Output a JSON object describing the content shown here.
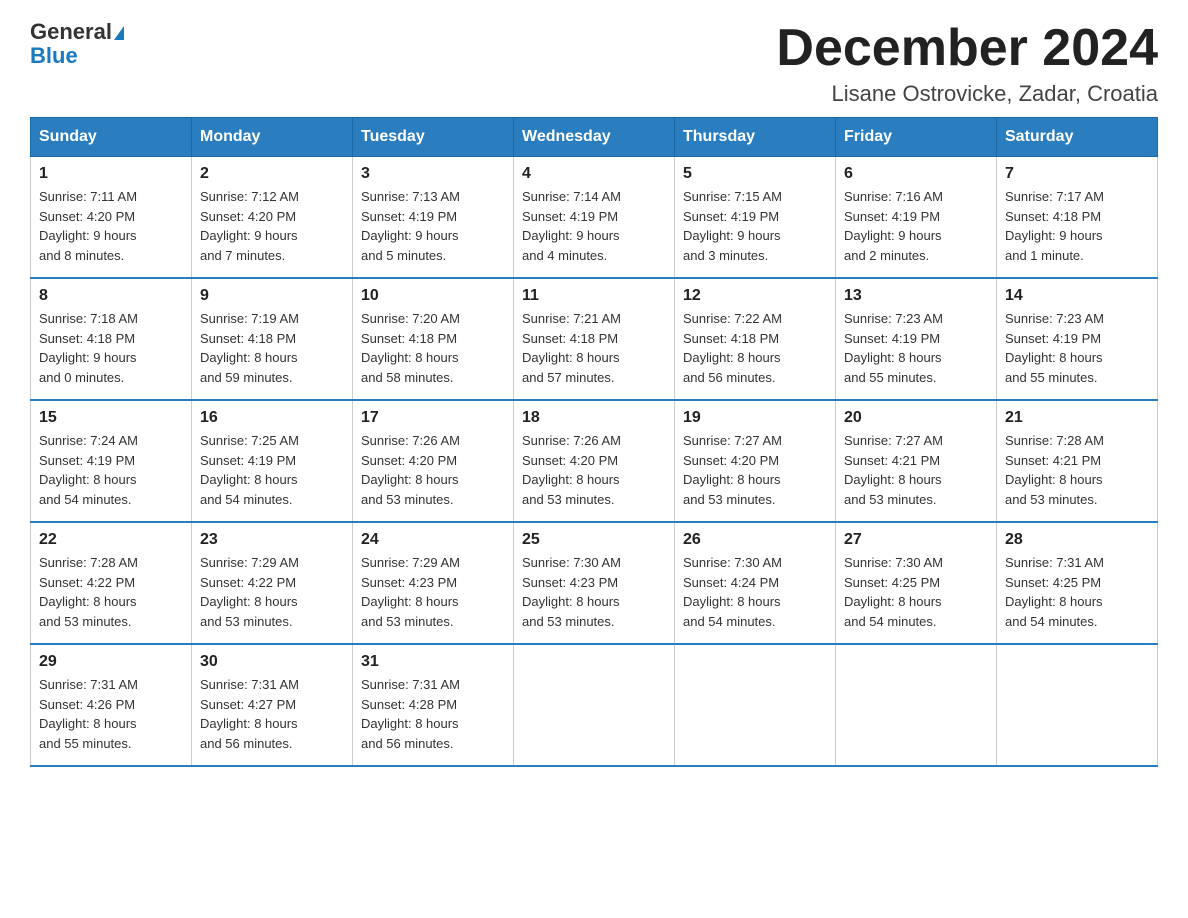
{
  "header": {
    "logo_line1": "General",
    "logo_line2": "Blue",
    "title": "December 2024",
    "subtitle": "Lisane Ostrovicke, Zadar, Croatia"
  },
  "days_of_week": [
    "Sunday",
    "Monday",
    "Tuesday",
    "Wednesday",
    "Thursday",
    "Friday",
    "Saturday"
  ],
  "weeks": [
    [
      {
        "day": "1",
        "info": "Sunrise: 7:11 AM\nSunset: 4:20 PM\nDaylight: 9 hours\nand 8 minutes."
      },
      {
        "day": "2",
        "info": "Sunrise: 7:12 AM\nSunset: 4:20 PM\nDaylight: 9 hours\nand 7 minutes."
      },
      {
        "day": "3",
        "info": "Sunrise: 7:13 AM\nSunset: 4:19 PM\nDaylight: 9 hours\nand 5 minutes."
      },
      {
        "day": "4",
        "info": "Sunrise: 7:14 AM\nSunset: 4:19 PM\nDaylight: 9 hours\nand 4 minutes."
      },
      {
        "day": "5",
        "info": "Sunrise: 7:15 AM\nSunset: 4:19 PM\nDaylight: 9 hours\nand 3 minutes."
      },
      {
        "day": "6",
        "info": "Sunrise: 7:16 AM\nSunset: 4:19 PM\nDaylight: 9 hours\nand 2 minutes."
      },
      {
        "day": "7",
        "info": "Sunrise: 7:17 AM\nSunset: 4:18 PM\nDaylight: 9 hours\nand 1 minute."
      }
    ],
    [
      {
        "day": "8",
        "info": "Sunrise: 7:18 AM\nSunset: 4:18 PM\nDaylight: 9 hours\nand 0 minutes."
      },
      {
        "day": "9",
        "info": "Sunrise: 7:19 AM\nSunset: 4:18 PM\nDaylight: 8 hours\nand 59 minutes."
      },
      {
        "day": "10",
        "info": "Sunrise: 7:20 AM\nSunset: 4:18 PM\nDaylight: 8 hours\nand 58 minutes."
      },
      {
        "day": "11",
        "info": "Sunrise: 7:21 AM\nSunset: 4:18 PM\nDaylight: 8 hours\nand 57 minutes."
      },
      {
        "day": "12",
        "info": "Sunrise: 7:22 AM\nSunset: 4:18 PM\nDaylight: 8 hours\nand 56 minutes."
      },
      {
        "day": "13",
        "info": "Sunrise: 7:23 AM\nSunset: 4:19 PM\nDaylight: 8 hours\nand 55 minutes."
      },
      {
        "day": "14",
        "info": "Sunrise: 7:23 AM\nSunset: 4:19 PM\nDaylight: 8 hours\nand 55 minutes."
      }
    ],
    [
      {
        "day": "15",
        "info": "Sunrise: 7:24 AM\nSunset: 4:19 PM\nDaylight: 8 hours\nand 54 minutes."
      },
      {
        "day": "16",
        "info": "Sunrise: 7:25 AM\nSunset: 4:19 PM\nDaylight: 8 hours\nand 54 minutes."
      },
      {
        "day": "17",
        "info": "Sunrise: 7:26 AM\nSunset: 4:20 PM\nDaylight: 8 hours\nand 53 minutes."
      },
      {
        "day": "18",
        "info": "Sunrise: 7:26 AM\nSunset: 4:20 PM\nDaylight: 8 hours\nand 53 minutes."
      },
      {
        "day": "19",
        "info": "Sunrise: 7:27 AM\nSunset: 4:20 PM\nDaylight: 8 hours\nand 53 minutes."
      },
      {
        "day": "20",
        "info": "Sunrise: 7:27 AM\nSunset: 4:21 PM\nDaylight: 8 hours\nand 53 minutes."
      },
      {
        "day": "21",
        "info": "Sunrise: 7:28 AM\nSunset: 4:21 PM\nDaylight: 8 hours\nand 53 minutes."
      }
    ],
    [
      {
        "day": "22",
        "info": "Sunrise: 7:28 AM\nSunset: 4:22 PM\nDaylight: 8 hours\nand 53 minutes."
      },
      {
        "day": "23",
        "info": "Sunrise: 7:29 AM\nSunset: 4:22 PM\nDaylight: 8 hours\nand 53 minutes."
      },
      {
        "day": "24",
        "info": "Sunrise: 7:29 AM\nSunset: 4:23 PM\nDaylight: 8 hours\nand 53 minutes."
      },
      {
        "day": "25",
        "info": "Sunrise: 7:30 AM\nSunset: 4:23 PM\nDaylight: 8 hours\nand 53 minutes."
      },
      {
        "day": "26",
        "info": "Sunrise: 7:30 AM\nSunset: 4:24 PM\nDaylight: 8 hours\nand 54 minutes."
      },
      {
        "day": "27",
        "info": "Sunrise: 7:30 AM\nSunset: 4:25 PM\nDaylight: 8 hours\nand 54 minutes."
      },
      {
        "day": "28",
        "info": "Sunrise: 7:31 AM\nSunset: 4:25 PM\nDaylight: 8 hours\nand 54 minutes."
      }
    ],
    [
      {
        "day": "29",
        "info": "Sunrise: 7:31 AM\nSunset: 4:26 PM\nDaylight: 8 hours\nand 55 minutes."
      },
      {
        "day": "30",
        "info": "Sunrise: 7:31 AM\nSunset: 4:27 PM\nDaylight: 8 hours\nand 56 minutes."
      },
      {
        "day": "31",
        "info": "Sunrise: 7:31 AM\nSunset: 4:28 PM\nDaylight: 8 hours\nand 56 minutes."
      },
      null,
      null,
      null,
      null
    ]
  ]
}
